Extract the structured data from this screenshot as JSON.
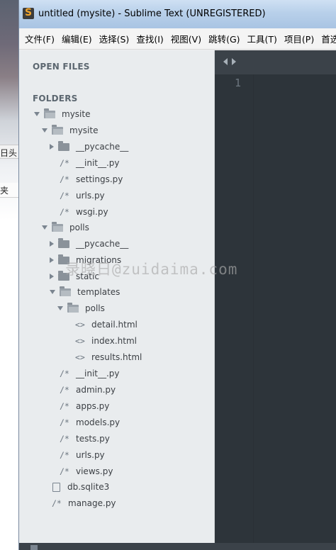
{
  "window": {
    "title": "untitled (mysite) - Sublime Text (UNREGISTERED)"
  },
  "desktop": {
    "sliver1": "日头",
    "sliver2": "夹"
  },
  "menubar": {
    "items": [
      "文件(F)",
      "编辑(E)",
      "选择(S)",
      "查找(I)",
      "视图(V)",
      "跳转(G)",
      "工具(T)",
      "项目(P)",
      "首选项"
    ]
  },
  "sidebar": {
    "open_files_label": "OPEN FILES",
    "folders_label": "FOLDERS",
    "tree": [
      {
        "label": "mysite"
      },
      {
        "label": "mysite"
      },
      {
        "label": "__pycache__"
      },
      {
        "label": "__init__.py",
        "icon": "/*"
      },
      {
        "label": "settings.py",
        "icon": "/*"
      },
      {
        "label": "urls.py",
        "icon": "/*"
      },
      {
        "label": "wsgi.py",
        "icon": "/*"
      },
      {
        "label": "polls"
      },
      {
        "label": "__pycache__"
      },
      {
        "label": "migrations"
      },
      {
        "label": "static"
      },
      {
        "label": "templates"
      },
      {
        "label": "polls"
      },
      {
        "label": "detail.html",
        "icon": "<>"
      },
      {
        "label": "index.html",
        "icon": "<>"
      },
      {
        "label": "results.html",
        "icon": "<>"
      },
      {
        "label": "__init__.py",
        "icon": "/*"
      },
      {
        "label": "admin.py",
        "icon": "/*"
      },
      {
        "label": "apps.py",
        "icon": "/*"
      },
      {
        "label": "models.py",
        "icon": "/*"
      },
      {
        "label": "tests.py",
        "icon": "/*"
      },
      {
        "label": "urls.py",
        "icon": "/*"
      },
      {
        "label": "views.py",
        "icon": "/*"
      },
      {
        "label": "db.sqlite3"
      },
      {
        "label": "manage.py",
        "icon": "/*"
      }
    ]
  },
  "editor": {
    "line_number": "1"
  },
  "watermark": "录晓日@zuidaima.com",
  "colors": {
    "sidebar_bg": "#e9ecee",
    "editor_bg": "#2d343a",
    "titlebar": "#b8d0ea"
  }
}
